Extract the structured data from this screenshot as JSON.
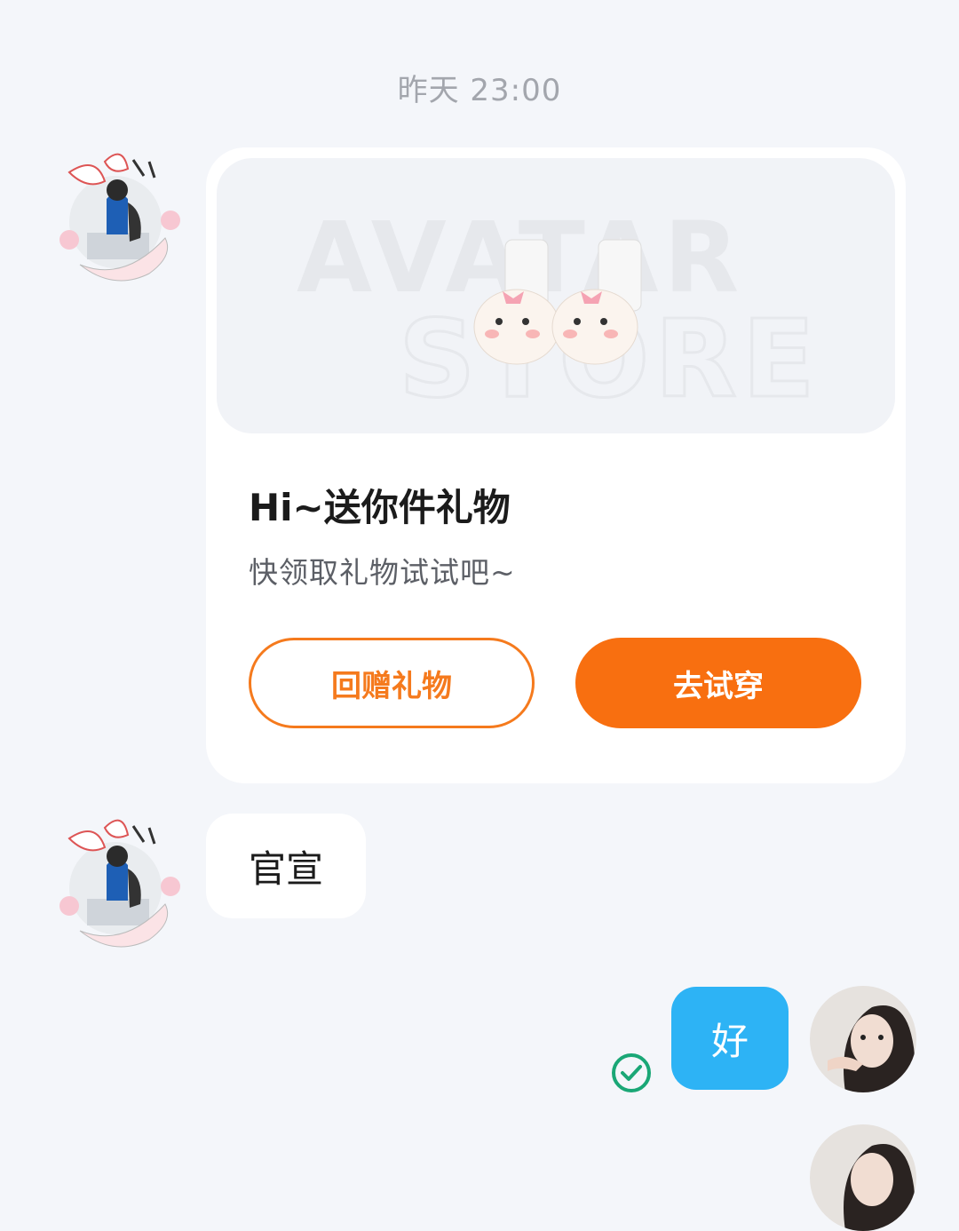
{
  "chat": {
    "timestamp": "昨天 23:00",
    "gift_card": {
      "banner_text_line1": "AVATAR",
      "banner_text_line2": "STORE",
      "title": "Hi~送你件礼物",
      "subtitle": "快领取礼物试试吧~",
      "return_gift_label": "回赠礼物",
      "try_on_label": "去试穿"
    },
    "message_left": "官宣",
    "message_right": "好"
  },
  "colors": {
    "background": "#f4f6fa",
    "accent_orange": "#f86f10",
    "bubble_blue": "#2db3f5",
    "read_check_green": "#1aa776"
  },
  "icons": {
    "read_status": "check-circle-icon"
  }
}
